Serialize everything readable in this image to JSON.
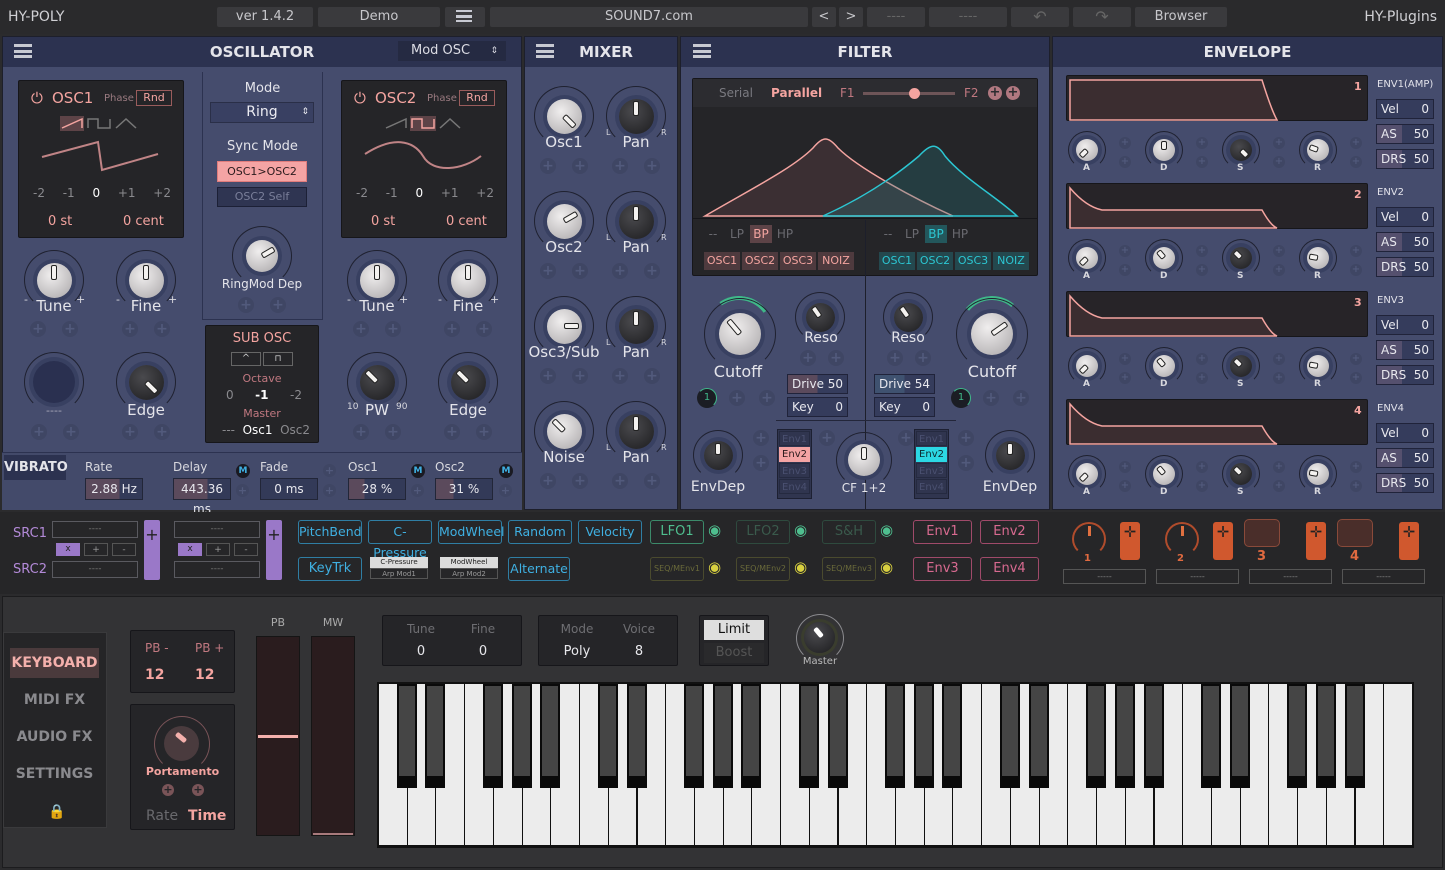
{
  "topbar": {
    "app_name": "HY-POLY",
    "version": "ver 1.4.2",
    "preset_bank": "Demo",
    "menu_icon": "hamburger-icon",
    "preset_name": "SOUND7.com",
    "prev": "<",
    "next": ">",
    "slot_a": "----",
    "slot_b": "----",
    "undo_icon": "undo-icon",
    "redo_icon": "redo-icon",
    "browser": "Browser",
    "vendor": "HY-Plugins"
  },
  "oscillator": {
    "title": "OSCILLATOR",
    "mod_select": "Mod OSC",
    "osc1": {
      "name": "OSC1",
      "phase": "Phase",
      "rnd": "Rnd",
      "octaves": [
        "-2",
        "-1",
        "0",
        "+1",
        "+2"
      ],
      "semitone": "0 st",
      "cent": "0 cent",
      "tune": "Tune",
      "fine": "Fine",
      "knob3": "----",
      "edge": "Edge"
    },
    "osc2": {
      "name": "OSC2",
      "phase": "Phase",
      "rnd": "Rnd",
      "octaves": [
        "-2",
        "-1",
        "0",
        "+1",
        "+2"
      ],
      "semitone": "0 st",
      "cent": "0 cent",
      "tune": "Tune",
      "fine": "Fine",
      "pw": "PW",
      "pw_min": "10",
      "pw_max": "90",
      "edge": "Edge"
    },
    "mode_label": "Mode",
    "mode_value": "Ring",
    "sync_label": "Sync Mode",
    "sync_active": "OSC1>OSC2",
    "sync_alt": "OSC2 Self",
    "ringmod": "RingMod Dep",
    "sub": {
      "title": "SUB OSC",
      "octave_label": "Octave",
      "octaves": [
        "0",
        "-1",
        "-2"
      ],
      "master_label": "Master",
      "masters": [
        "---",
        "Osc1",
        "Osc2"
      ]
    },
    "vibrato": {
      "title": "VIBRATO",
      "rate_label": "Rate",
      "rate": "2.88 Hz",
      "delay_label": "Delay",
      "delay": "443.36 ms",
      "fade_label": "Fade",
      "fade": "0 ms",
      "osc1_label": "Osc1",
      "osc1": "28 %",
      "osc2_label": "Osc2",
      "osc2": "31 %"
    }
  },
  "mixer": {
    "title": "MIXER",
    "channels": [
      {
        "name": "Osc1",
        "pan": "Pan"
      },
      {
        "name": "Osc2",
        "pan": "Pan"
      },
      {
        "name": "Osc3/Sub",
        "pan": "Pan"
      },
      {
        "name": "Noise",
        "pan": "Pan"
      }
    ],
    "pan_l": "L",
    "pan_r": "R"
  },
  "filter": {
    "title": "FILTER",
    "serial": "Serial",
    "parallel": "Parallel",
    "f1": "F1",
    "f2": "F2",
    "balance": 0.55,
    "f1_types": [
      "--",
      "LP",
      "BP",
      "HP"
    ],
    "f1_active": "BP",
    "f2_types": [
      "--",
      "LP",
      "BP",
      "HP"
    ],
    "f2_active": "BP",
    "sources": [
      "OSC1",
      "OSC2",
      "OSC3",
      "NOIZ"
    ],
    "cutoff": "Cutoff",
    "reso": "Reso",
    "drive_label": "Drive",
    "f1_drive": "50",
    "f2_drive": "54",
    "key_label": "Key",
    "f1_key": "0",
    "f2_key": "0",
    "envdep": "EnvDep",
    "cf": "CF 1+2",
    "env_opts": [
      "Env1",
      "Env2",
      "Env3",
      "Env4"
    ],
    "env_active": "Env2",
    "colors": {
      "f1": "#f4a4a0",
      "f2": "#2cc6d2"
    }
  },
  "envelope": {
    "title": "ENVELOPE",
    "envs": [
      {
        "num": "1",
        "name": "ENV1(AMP)",
        "vel": "0",
        "as": "50",
        "drs": "50"
      },
      {
        "num": "2",
        "name": "ENV2",
        "vel": "0",
        "as": "50",
        "drs": "50"
      },
      {
        "num": "3",
        "name": "ENV3",
        "vel": "0",
        "as": "50",
        "drs": "50"
      },
      {
        "num": "4",
        "name": "ENV4",
        "vel": "0",
        "as": "50",
        "drs": "50"
      }
    ],
    "vel_label": "Vel",
    "as_label": "AS",
    "drs_label": "DRS",
    "adsr": [
      "A",
      "D",
      "S",
      "R"
    ]
  },
  "modmatrix": {
    "src1": "SRC1",
    "src2": "SRC2",
    "empty": "----",
    "ops": [
      "x",
      "+",
      "-"
    ],
    "blue": [
      "PitchBend",
      "C-Pressure",
      "ModWheel",
      "Random",
      "Velocity"
    ],
    "keytrk": "KeyTrk",
    "arp1_top": "C-Pressure",
    "arp1_bot": "Arp Mod1",
    "arp2_top": "ModWheel",
    "arp2_bot": "Arp Mod2",
    "alternate": "Alternate",
    "lfos": [
      "LFO1",
      "LFO2",
      "S&H"
    ],
    "seqs": [
      "SEQ/MEnv1",
      "SEQ/MEnv2",
      "SEQ/MEnv3"
    ],
    "envs": [
      "Env1",
      "Env2",
      "Env3",
      "Env4"
    ],
    "macros": [
      {
        "num": "1",
        "label": "-----"
      },
      {
        "num": "2",
        "label": "-----"
      },
      {
        "num": "3",
        "label": "-----"
      },
      {
        "num": "4",
        "label": "-----"
      }
    ]
  },
  "bottom": {
    "tabs": [
      "KEYBOARD",
      "MIDI FX",
      "AUDIO FX",
      "SETTINGS"
    ],
    "active_tab": "KEYBOARD",
    "pb_minus_label": "PB -",
    "pb_minus": "12",
    "pb_plus_label": "PB +",
    "pb_plus": "12",
    "portamento": "Portamento",
    "rate": "Rate",
    "time": "Time",
    "pb": "PB",
    "mw": "MW",
    "pb_value": 0.5,
    "mw_value": 0.0,
    "tune_label": "Tune",
    "tune": "0",
    "fine_label": "Fine",
    "fine": "0",
    "mode_label": "Mode",
    "mode": "Poly",
    "voice_label": "Voice",
    "voice": "8",
    "limit": "Limit",
    "boost": "Boost",
    "master": "Master",
    "white_keys": 36
  }
}
